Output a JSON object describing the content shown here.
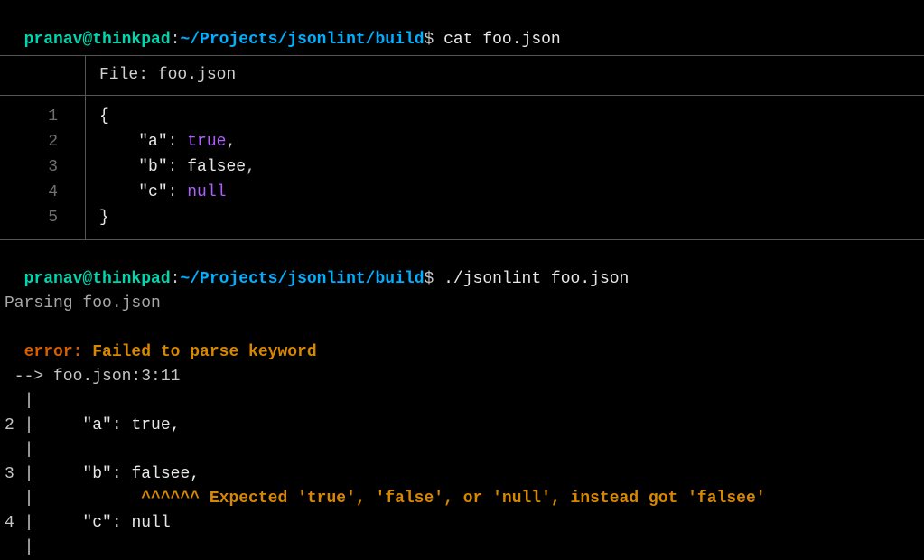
{
  "prompt1": {
    "user_host": "pranav@thinkpad",
    "colon": ":",
    "path": "~/Projects/jsonlint/build",
    "dollar": "$",
    "command": " cat foo.json"
  },
  "file_header": "File: foo.json",
  "code": {
    "line_nums": [
      "1",
      "2",
      "3",
      "4",
      "5"
    ],
    "lines": {
      "l1_brace": "{",
      "l2_indent": "    ",
      "l2_key": "\"a\"",
      "l2_sep": ": ",
      "l2_val": "true",
      "l2_comma": ",",
      "l3_indent": "    ",
      "l3_key": "\"b\"",
      "l3_sep": ": ",
      "l3_val": "falsee",
      "l3_comma": ",",
      "l4_indent": "    ",
      "l4_key": "\"c\"",
      "l4_sep": ": ",
      "l4_val": "null",
      "l5_brace": "}"
    }
  },
  "prompt2": {
    "user_host": "pranav@thinkpad",
    "colon": ":",
    "path": "~/Projects/jsonlint/build",
    "dollar": "$",
    "command": " ./jsonlint foo.json"
  },
  "parsing": "Parsing foo.json",
  "error": {
    "label": "error:",
    "msg": " Failed to parse keyword"
  },
  "location": " --> foo.json:3:11",
  "diag": {
    "pipe_only": "  |",
    "l2_num": "2 ",
    "l2_pipe": "|",
    "l2_code": "     \"a\": true,",
    "l3_num": "3 ",
    "l3_pipe": "|",
    "l3_code": "     \"b\": falsee,",
    "caret_prefix": "  |           ",
    "carets": "^^^^^^",
    "caret_msg": " Expected 'true', 'false', or 'null', instead got 'falsee'",
    "l4_num": "4 ",
    "l4_pipe": "|",
    "l4_code": "     \"c\": null"
  }
}
